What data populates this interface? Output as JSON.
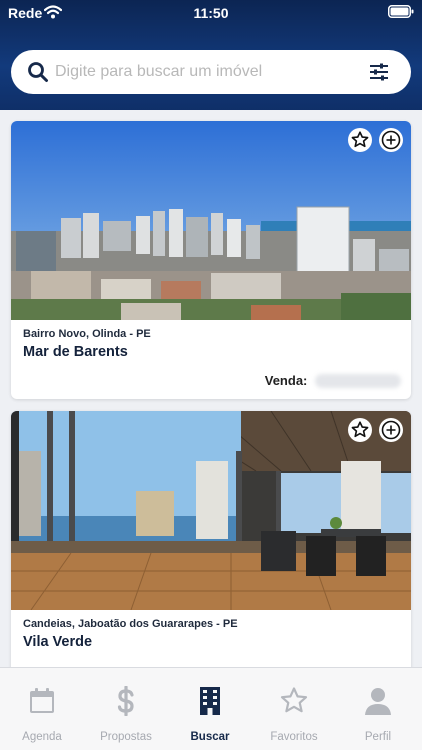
{
  "status_bar": {
    "carrier": "Rede",
    "time": "11:50"
  },
  "search": {
    "placeholder": "Digite para buscar um imóvel",
    "value": ""
  },
  "listings": [
    {
      "location": "Bairro Novo, Olinda - PE",
      "title": "Mar de Barents",
      "price_label": "Venda:"
    },
    {
      "location": "Candeias, Jaboatão dos Guararapes - PE",
      "title": "Vila Verde",
      "price_label": ""
    }
  ],
  "tabs": [
    {
      "label": "Agenda",
      "icon": "calendar-icon",
      "active": false
    },
    {
      "label": "Propostas",
      "icon": "dollar-icon",
      "active": false
    },
    {
      "label": "Buscar",
      "icon": "building-icon",
      "active": true
    },
    {
      "label": "Favoritos",
      "icon": "star-icon",
      "active": false
    },
    {
      "label": "Perfil",
      "icon": "user-icon",
      "active": false
    }
  ],
  "colors": {
    "header": "#123a7c",
    "active_tab": "#16294a",
    "inactive_tab": "#a6a9b0"
  }
}
